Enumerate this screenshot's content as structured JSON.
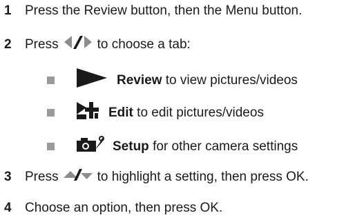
{
  "steps": [
    {
      "num": "1",
      "text": "Press the Review button, then the Menu button."
    },
    {
      "num": "2",
      "pre": "Press",
      "post": "to choose a tab:"
    },
    {
      "num": "3",
      "pre": "Press",
      "post": "to highlight a setting, then press OK."
    },
    {
      "num": "4",
      "text": "Choose an option, then press OK."
    }
  ],
  "tabs": [
    {
      "icon": "review-play-icon",
      "name": "Review",
      "desc": "to view pictures/videos"
    },
    {
      "icon": "edit-icon",
      "name": "Edit",
      "desc": "to edit pictures/videos"
    },
    {
      "icon": "setup-camera-icon",
      "name": "Setup",
      "desc": "for other camera settings"
    }
  ],
  "colors": {
    "icon": "#1a1a1a",
    "arrow": "#8c8c8c",
    "bullet": "#9a9a9a"
  }
}
